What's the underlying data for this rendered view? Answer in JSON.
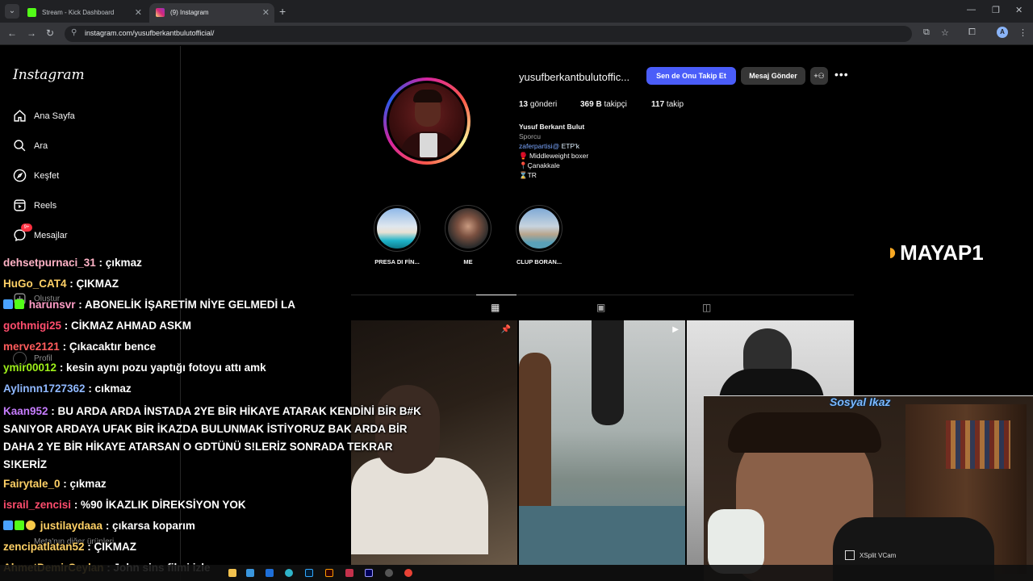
{
  "browser": {
    "tabs": [
      {
        "title": "Stream - Kick Dashboard",
        "favicon_color": "#53fc18"
      },
      {
        "title": "(9) Instagram",
        "favicon_color": "#e1306c"
      }
    ],
    "url": "instagram.com/yusufberkantbulutofficial/",
    "profile_initial": "A"
  },
  "sidebar": {
    "logo": "Instagram",
    "items": [
      {
        "label": "Ana Sayfa",
        "icon": "home-icon"
      },
      {
        "label": "Ara",
        "icon": "search-icon"
      },
      {
        "label": "Keşfet",
        "icon": "explore-icon"
      },
      {
        "label": "Reels",
        "icon": "reels-icon"
      },
      {
        "label": "Mesajlar",
        "icon": "messages-icon",
        "badge": "9+"
      },
      {
        "label": "Oluştur",
        "icon": "create-icon"
      },
      {
        "label": "Profil",
        "icon": "profile-icon"
      },
      {
        "label": "Meta'nın diğer ürünleri",
        "icon": "meta-icon"
      }
    ]
  },
  "profile": {
    "username": "yusufberkantbulutoffic...",
    "follow_button": "Sen de Onu Takip Et",
    "message_button": "Mesaj Gönder",
    "stats": {
      "posts_count": "13",
      "posts_label": "gönderi",
      "followers_count": "369 B",
      "followers_label": "takipçi",
      "following_count": "117",
      "following_label": "takip"
    },
    "bio": {
      "name": "Yusuf Berkant Bulut",
      "category": "Sporcu",
      "link_handle": "zaferpartisi@",
      "link_text": " ETP'k",
      "line1": "🥊 Middleweight boxer",
      "line2": "📍Çanakkale",
      "line3": "⌛TR"
    }
  },
  "highlights": [
    {
      "label": "PRESA DI FİN..."
    },
    {
      "label": "ME"
    },
    {
      "label": "CLUP BORAN..."
    }
  ],
  "overlay": {
    "logo_text": "MAYAP1",
    "camera_title": "Sosyal Ikaz",
    "camera_watermark": "XSplit VCam"
  },
  "chat": [
    {
      "user": "dehsetpurnaci_31",
      "color": "#ffb3c6",
      "text": " : çıkmaz"
    },
    {
      "user": "HuGo_CAT4",
      "color": "#ffd166",
      "text": " : ÇIKMAZ"
    },
    {
      "user": "harunsvr",
      "color": "#ff9ec7",
      "text": " : ABONELİK İŞARETİM NİYE GELMEDİ LA",
      "badges": true
    },
    {
      "user": "gothmigi25",
      "color": "#ff4d6d",
      "text": " : CİKMAZ AHMAD ASKM"
    },
    {
      "user": "merve2121",
      "color": "#ff5c5c",
      "text": " : Çıkacaktır bence"
    },
    {
      "user": "ymir00012",
      "color": "#9ef01a",
      "text": " : kesin aynı pozu yaptığı fotoyu attı amk"
    },
    {
      "user": "Aylinnn1727362",
      "color": "#8fb8ff",
      "text": " : cıkmaz"
    },
    {
      "user": "Kaan952",
      "color": "#c77dff",
      "text": " : BU ARDA ARDA İNSTADA 2YE BİR HİKAYE ATARAK KENDİNİ BİR B#K SANIYOR ARDAYA UFAK BİR İKAZDA BULUNMAK İSTİYORUZ BAK ARDA BİR DAHA 2 YE BİR HİKAYE ATARSAN O GDTÜNÜ S!LERİZ SONRADA TEKRAR S!KERİZ"
    },
    {
      "user": "Fairytale_0",
      "color": "#ffd166",
      "text": " : çıkmaz"
    },
    {
      "user": "israil_zencisi",
      "color": "#ff4d6d",
      "text": " : %90 İKAZLIK DİREKSİYON YOK"
    },
    {
      "user": "justilaydaaa",
      "color": "#ffd166",
      "text": " : çıkarsa koparım",
      "badges": true
    },
    {
      "user": "zencipatlatan52",
      "color": "#ffd166",
      "text": " : ÇIKMAZ"
    },
    {
      "user": "AhmetDemirCeylan",
      "color": "#ffd166",
      "text": " : John sins filmi izle"
    }
  ]
}
